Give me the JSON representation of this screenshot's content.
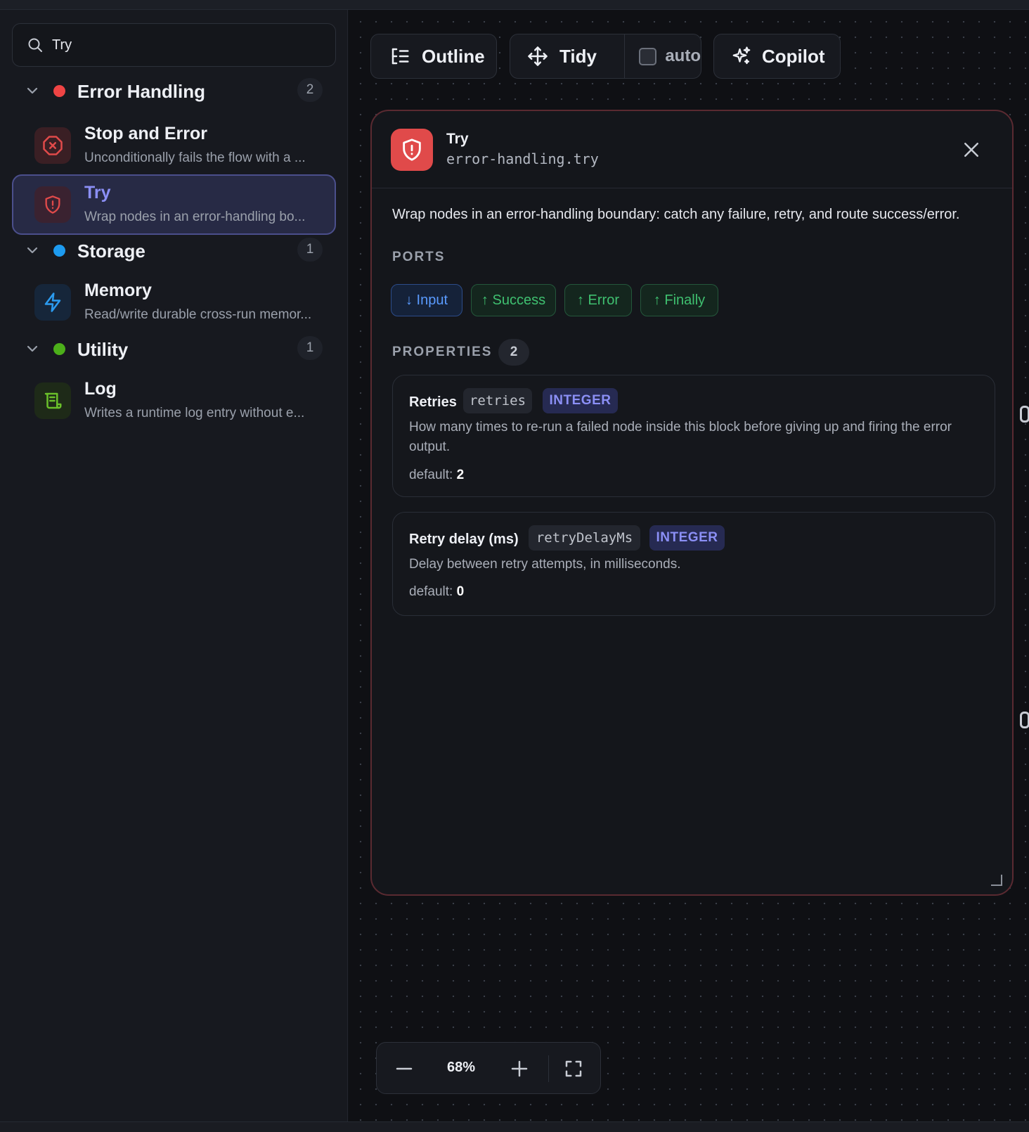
{
  "search": {
    "value": "Try",
    "placeholder": ""
  },
  "sidebar": {
    "groups": [
      {
        "name": "Error Handling",
        "count": "2",
        "dot_color": "#ef4444"
      },
      {
        "name": "Storage",
        "count": "1",
        "dot_color": "#1d9bf0"
      },
      {
        "name": "Utility",
        "count": "1",
        "dot_color": "#4caf1a"
      }
    ],
    "items": [
      {
        "name": "Stop and Error",
        "desc": "Unconditionally fails the flow with a ...",
        "icon": "x-circle-icon"
      },
      {
        "name": "Try",
        "desc": "Wrap nodes in an error-handling bo...",
        "icon": "shield-alert-icon"
      },
      {
        "name": "Memory",
        "desc": "Read/write durable cross-run memor...",
        "icon": "lightning-icon"
      },
      {
        "name": "Log",
        "desc": "Writes a runtime log entry without e...",
        "icon": "scroll-icon"
      }
    ]
  },
  "toolbar": {
    "outline_label": "Outline",
    "tidy_label": "Tidy",
    "auto_label": "auto",
    "copilot_label": "Copilot"
  },
  "panel": {
    "title": "Try",
    "type": "error-handling.try",
    "description": "Wrap nodes in an error-handling boundary: catch any failure, retry, and route success/error.",
    "ports_heading": "PORTS",
    "ports": [
      {
        "label": "↓ Input",
        "kind": "input"
      },
      {
        "label": "↑ Success",
        "kind": "output"
      },
      {
        "label": "↑ Error",
        "kind": "output"
      },
      {
        "label": "↑ Finally",
        "kind": "output"
      }
    ],
    "properties_heading": "PROPERTIES",
    "properties_count": "2",
    "properties": [
      {
        "label": "Retries",
        "key": "retries",
        "type": "INTEGER",
        "description": "How many times to re-run a failed node inside this block before giving up and firing the error output.",
        "default_prefix": "default:",
        "default_value": "2"
      },
      {
        "label": "Retry delay (ms)",
        "key": "retryDelayMs",
        "type": "INTEGER",
        "description": "Delay between retry attempts, in milliseconds.",
        "default_prefix": "default:",
        "default_value": "0"
      }
    ]
  },
  "zoom": {
    "level": "68%"
  },
  "colors": {
    "accent": "#8b8ff5",
    "error": "#e04a4a",
    "success": "#3fc070",
    "input": "#5a9bff"
  }
}
